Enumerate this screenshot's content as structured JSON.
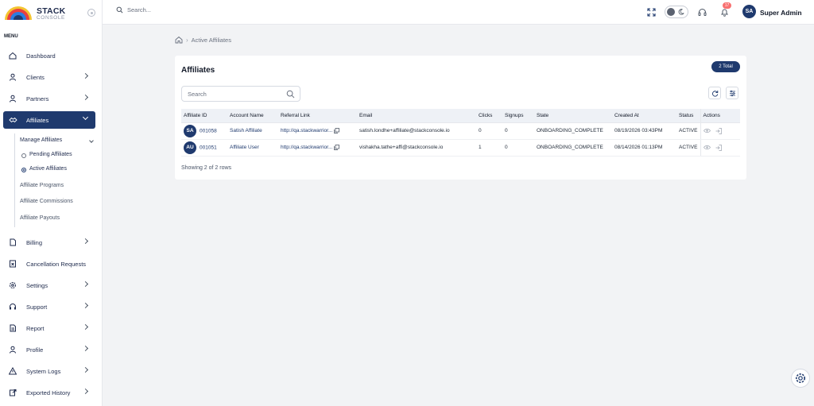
{
  "brand": {
    "name": "STACK",
    "sub": "CONSOLE"
  },
  "sidebar": {
    "menu_label": "MENU",
    "items": [
      {
        "label": "Dashboard"
      },
      {
        "label": "Clients"
      },
      {
        "label": "Partners"
      },
      {
        "label": "Affiliates"
      },
      {
        "label": "Billing"
      },
      {
        "label": "Cancellation Requests"
      },
      {
        "label": "Settings"
      },
      {
        "label": "Support"
      },
      {
        "label": "Report"
      },
      {
        "label": "Profile"
      },
      {
        "label": "System Logs"
      },
      {
        "label": "Exported History"
      }
    ],
    "sub": {
      "manage": "Manage Affiliates",
      "pending": "Pending Affiliates",
      "active": "Active Affiliates",
      "programs": "Affiliate Programs",
      "commissions": "Affiliate Commissions",
      "payouts": "Affiliate Payouts"
    }
  },
  "topbar": {
    "search_placeholder": "Search...",
    "notification_count": "17",
    "user_initials": "SA",
    "user_name": "Super Admin"
  },
  "breadcrumb": {
    "current": "Active Affiliates"
  },
  "card": {
    "title": "Affiliates",
    "total": "2 Total",
    "search_placeholder": "Search",
    "showing": "Showing 2 of 2 rows"
  },
  "table": {
    "headers": [
      "Affiliate ID",
      "Account Name",
      "Referral Link",
      "Email",
      "Clicks",
      "Signups",
      "State",
      "Created At",
      "Status",
      "Actions"
    ],
    "rows": [
      {
        "initials": "SA",
        "id": "001058",
        "name": "Satish Affiliate",
        "link": "http://qa.stackwarrior...",
        "email": "satish.londhe+affiliate@stackconsole.io",
        "clicks": "0",
        "signups": "0",
        "state": "ONBOARDING_COMPLETE",
        "created": "08/19/2026 03:43PM",
        "status": "ACTIVE"
      },
      {
        "initials": "AU",
        "id": "001051",
        "name": "Affiliate User",
        "link": "http://qa.stackwarrior...",
        "email": "vishakha.tathe+affi@stackconsole.io",
        "clicks": "1",
        "signups": "0",
        "state": "ONBOARDING_COMPLETE",
        "created": "08/14/2026 01:13PM",
        "status": "ACTIVE"
      }
    ]
  },
  "colors": {
    "primary": "#1f3a6e",
    "badge": "#f87171"
  }
}
